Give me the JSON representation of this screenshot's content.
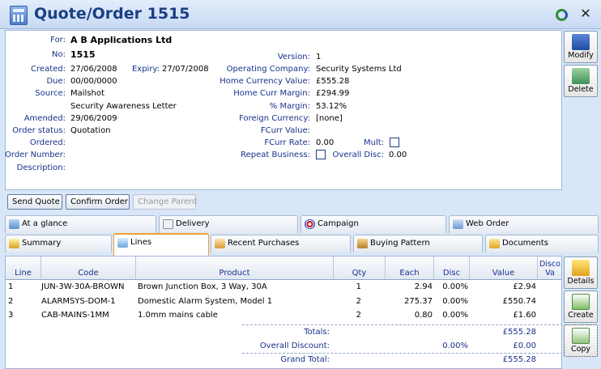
{
  "window": {
    "title": "Quote/Order 1515"
  },
  "header": {
    "for_label": "For:",
    "for_value": "A B Applications Ltd",
    "no_label": "No:",
    "no_value": "1515",
    "created_label": "Created:",
    "created_value": "27/06/2008",
    "expiry_label": "Expiry:",
    "expiry_value": "27/07/2008",
    "due_label": "Due:",
    "due_value": "00/00/0000",
    "source_label": "Source:",
    "source_value": "Mailshot",
    "source_value2": "Security Awareness Letter",
    "amended_label": "Amended:",
    "amended_value": "29/06/2009",
    "status_label": "Order status:",
    "status_value": "Quotation",
    "ordered_label": "Ordered:",
    "order_number_label": "Order Number:",
    "description_label": "Description:",
    "version_label": "Version:",
    "version_value": "1",
    "operating_label": "Operating Company:",
    "operating_value": "Security Systems Ltd",
    "home_value_label": "Home Currency Value:",
    "home_value": "£555.28",
    "home_margin_label": "Home Curr Margin:",
    "home_margin": "£294.99",
    "pct_margin_label": "% Margin:",
    "pct_margin": "53.12%",
    "foreign_label": "Foreign Currency:",
    "foreign_value": "[none]",
    "fcurr_value_label": "FCurr Value:",
    "fcurr_rate_label": "FCurr Rate:",
    "fcurr_rate": "0.00",
    "mult_label": "Mult:",
    "repeat_label": "Repeat Business:",
    "overall_disc_label": "Overall Disc:",
    "overall_disc": "0.00"
  },
  "side_buttons": {
    "modify": "Modify",
    "delete": "Delete",
    "details": "Details",
    "create": "Create",
    "copy": "Copy"
  },
  "actions": {
    "send_quote": "Send Quote",
    "confirm_order": "Confirm Order",
    "change_parent": "Change Parent"
  },
  "tabs_row1": [
    "At a glance",
    "Delivery",
    "Campaign",
    "Web Order"
  ],
  "tabs_row2": [
    "Summary",
    "Lines",
    "Recent Purchases",
    "Buying Pattern",
    "Documents"
  ],
  "grid": {
    "headers": {
      "line": "Line",
      "code": "Code",
      "product": "Product",
      "qty": "Qty",
      "each": "Each",
      "disc": "Disc",
      "value": "Value",
      "discval": "Disco Va"
    },
    "rows": [
      {
        "line": "1",
        "code": "JUN-3W-30A-BROWN",
        "product": "Brown Junction Box, 3 Way, 30A",
        "qty": "1",
        "each": "2.94",
        "disc": "0.00%",
        "value": "£2.94"
      },
      {
        "line": "2",
        "code": "ALARMSYS-DOM-1",
        "product": "Domestic Alarm System, Model 1",
        "qty": "2",
        "each": "275.37",
        "disc": "0.00%",
        "value": "£550.74"
      },
      {
        "line": "3",
        "code": "CAB-MAINS-1MM",
        "product": "1.0mm mains cable",
        "qty": "2",
        "each": "0.80",
        "disc": "0.00%",
        "value": "£1.60"
      }
    ],
    "totals_label": "Totals:",
    "totals_value": "£555.28",
    "overall_discount_label": "Overall Discount:",
    "overall_discount_pct": "0.00%",
    "overall_discount_value": "£0.00",
    "grand_total_label": "Grand Total:",
    "grand_total_value": "£555.28"
  }
}
